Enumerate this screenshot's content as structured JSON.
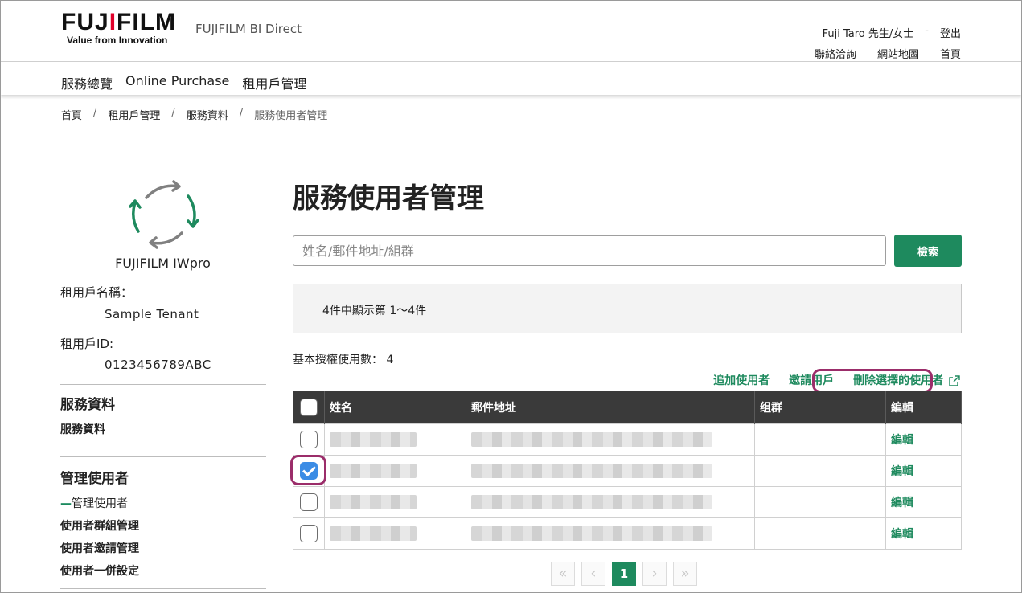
{
  "header": {
    "logo_main_left": "FUJ",
    "logo_main_mid": "I",
    "logo_main_right": "FILM",
    "logo_tagline": "Value from Innovation",
    "site_name": "FUJIFILM BI Direct",
    "user_name": "Fuji Taro 先生/女士",
    "user_sep": "-",
    "logout": "登出",
    "links": [
      "聯絡洽詢",
      "網站地圖",
      "首頁"
    ]
  },
  "nav": {
    "items": [
      "服務總覽",
      "Online Purchase",
      "租用戶管理"
    ]
  },
  "breadcrumb": {
    "items": [
      "首頁",
      "租用戶管理",
      "服務資料",
      "服務使用者管理"
    ],
    "separator": "/"
  },
  "sidebar": {
    "service_name": "FUJIFILM IWpro",
    "tenant_name_label": "租用戶名稱：",
    "tenant_name": "Sample Tenant",
    "tenant_id_label": "租用戶ID:",
    "tenant_id": "0123456789ABC",
    "section1_title": "服務資料",
    "section1_items": [
      "服務資料"
    ],
    "section2_title": "管理使用者",
    "section2_items": [
      "管理使用者",
      "使用者群組管理",
      "使用者邀請管理",
      "使用者一併設定"
    ],
    "active_marker": "—"
  },
  "main": {
    "title": "服務使用者管理",
    "search_placeholder": "姓名/郵件地址/組群",
    "search_button": "檢索",
    "result_summary": "4件中顯示第 1～4件",
    "license_label": "基本授權使用數：",
    "license_count": "4",
    "actions": {
      "add_user": "追加使用者",
      "invite_user": "邀請用戶",
      "delete_selected": "刪除選擇的使用者"
    }
  },
  "table": {
    "headers": {
      "name": "姓名",
      "email": "郵件地址",
      "group": "组群",
      "edit": "編輯"
    },
    "rows": [
      {
        "checked": false,
        "edit": "編輯"
      },
      {
        "checked": true,
        "edit": "編輯"
      },
      {
        "checked": false,
        "edit": "編輯"
      },
      {
        "checked": false,
        "edit": "編輯"
      }
    ]
  },
  "pagination": {
    "first": "«",
    "prev": "‹",
    "current": "1",
    "next": "›",
    "last": "»"
  },
  "colors": {
    "accent": "#1e8a5e",
    "highlight": "#9b2d6a",
    "checkbox": "#3b8ce5",
    "header_bg": "#3a3a3a"
  }
}
